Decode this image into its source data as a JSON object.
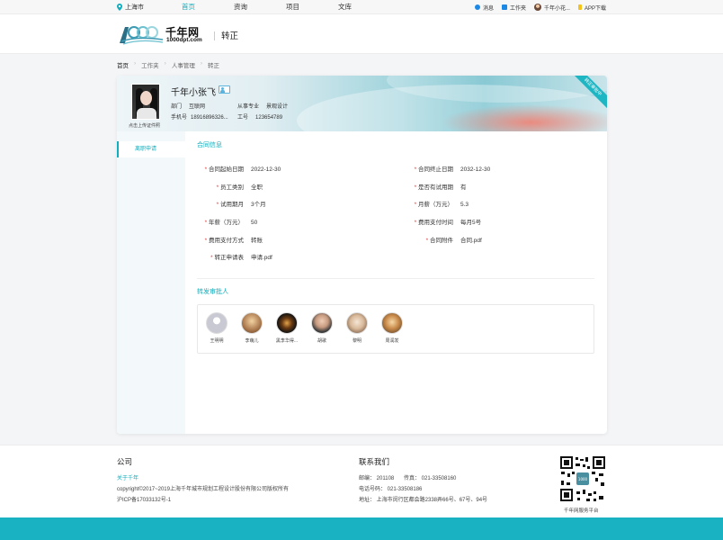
{
  "topbar": {
    "location": "上海市",
    "nav": [
      "首页",
      "资询",
      "项目",
      "文库"
    ],
    "active_nav": 0,
    "right": {
      "message": "消息",
      "workbench": "工作夹",
      "user": "千年小花...",
      "app": "APP下载"
    }
  },
  "header": {
    "logo_text": "千年网",
    "logo_sub": "1000dpt.com",
    "page_title": "转正"
  },
  "breadcrumb": [
    "首页",
    "工作夹",
    "人事管理",
    "转正"
  ],
  "profile": {
    "photo_caption": "点击上传证件照",
    "name": "千年小张飞",
    "dept_label": "部门",
    "dept_value": "互联网",
    "major_label": "从事专业",
    "major_value": "景观设计",
    "phone_label": "手机号",
    "phone_value": "18916896326...",
    "id_label": "工号",
    "id_value": "123654789",
    "ribbon": "转正审批中"
  },
  "sidebar": {
    "items": [
      "离职申请"
    ]
  },
  "contract": {
    "section_title": "合同信息",
    "left": [
      {
        "label": "合同起始日期",
        "value": "2022-12-30"
      },
      {
        "label": "员工类别",
        "value": "全职"
      },
      {
        "label": "试用期月",
        "value": "3个月"
      },
      {
        "label": "年薪（万元）",
        "value": "50"
      },
      {
        "label": "费用支付方式",
        "value": "转账"
      },
      {
        "label": "转正申请表",
        "value": "申请.pdf"
      }
    ],
    "right": [
      {
        "label": "合同终止日期",
        "value": "2032-12-30"
      },
      {
        "label": "是否有试用期",
        "value": "有"
      },
      {
        "label": "月薪（万元）",
        "value": "5.3"
      },
      {
        "label": "费用支付时间",
        "value": "每月5号"
      },
      {
        "label": "合同附件",
        "value": "合同.pdf"
      }
    ]
  },
  "approvers": {
    "section_title": "转发审批人",
    "people": [
      {
        "name": "王明明"
      },
      {
        "name": "李萌儿"
      },
      {
        "name": "黑李华得..."
      },
      {
        "name": "胡歌"
      },
      {
        "name": "黎明"
      },
      {
        "name": "周润发"
      }
    ]
  },
  "footer": {
    "company_title": "公司",
    "about_link": "关于千年",
    "copyright": "copyright©2017~2019上海千年城市规划工程设计股份有限公司版权所有",
    "icp": "沪ICP备17033132号-1",
    "contact_title": "联系我们",
    "postcode": "邮编：  201108",
    "fax": "传真：  021-33508160",
    "tel": "电话号码：  021-33508186",
    "address": "地址：  上海市闵行区都会路2338弄66号、67号、94号",
    "qr_caption": "千年网服务平台"
  },
  "colors": {
    "accent": "#11aebd",
    "footer_bar": "#19b2c2",
    "required": "#e23b3b"
  }
}
